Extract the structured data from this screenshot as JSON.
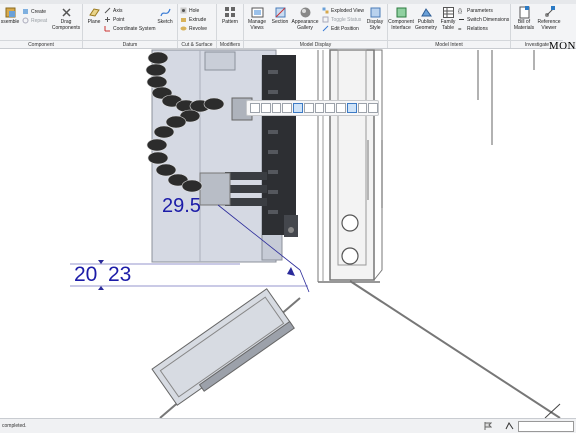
{
  "ribbon": {
    "assemble_label": "ssemble",
    "create_label": "Create",
    "repeat_label": "Repeat",
    "drag_components_label": "Drag Components",
    "plane_label": "Plane",
    "axis_label": "Axis",
    "point_label": "Point",
    "coordinate_system_label": "Coordinate System",
    "sketch_label": "Sketch",
    "hole_label": "Hole",
    "extrude_label": "Extrude",
    "revolve_label": "Revolve",
    "pattern_label": "Pattern",
    "manage_views_label": "Manage Views",
    "section_label": "Section",
    "appearance_gallery_label": "Appearance Gallery",
    "exploded_view_label": "Exploded View",
    "toggle_status_label": "Toggle Status",
    "edit_position_label": "Edit Position",
    "display_style_label": "Display Style",
    "component_interface_label": "Component Interface",
    "publish_geometry_label": "Publish Geometry",
    "family_table_label": "Family Table",
    "parameters_label": "Parameters",
    "switch_dimensions_label": "Switch Dimensions",
    "relations_label": "Relations",
    "bill_of_materials_label": "Bill of Materials",
    "reference_viewer_label": "Reference Viewer",
    "groups": {
      "component": "Component",
      "datum": "Datum",
      "cut_surface": "Cut & Surface",
      "modifiers": "Modifiers",
      "model_display": "Model Display",
      "model_intent": "Model Intent",
      "investigate": "Investigate"
    }
  },
  "canvas": {
    "dimension_1": "29.5",
    "dimension_2_left": "20",
    "dimension_2_right": "23",
    "dimension_color": "#1c1ca8"
  },
  "logo_text": "MON",
  "status": {
    "message": "completed."
  },
  "icons": [
    "assemble-icon",
    "create-icon",
    "repeat-icon",
    "drag-components-icon",
    "plane-icon",
    "axis-icon",
    "point-icon",
    "coordinate-system-icon",
    "sketch-icon",
    "hole-icon",
    "extrude-icon",
    "revolve-icon",
    "pattern-icon",
    "manage-views-icon",
    "section-icon",
    "appearance-gallery-icon",
    "exploded-view-icon",
    "toggle-status-icon",
    "edit-position-icon",
    "display-style-icon",
    "component-interface-icon",
    "publish-geometry-icon",
    "family-table-icon",
    "parameters-icon",
    "switch-dimensions-icon",
    "relations-icon",
    "bill-of-materials-icon",
    "reference-viewer-icon"
  ]
}
